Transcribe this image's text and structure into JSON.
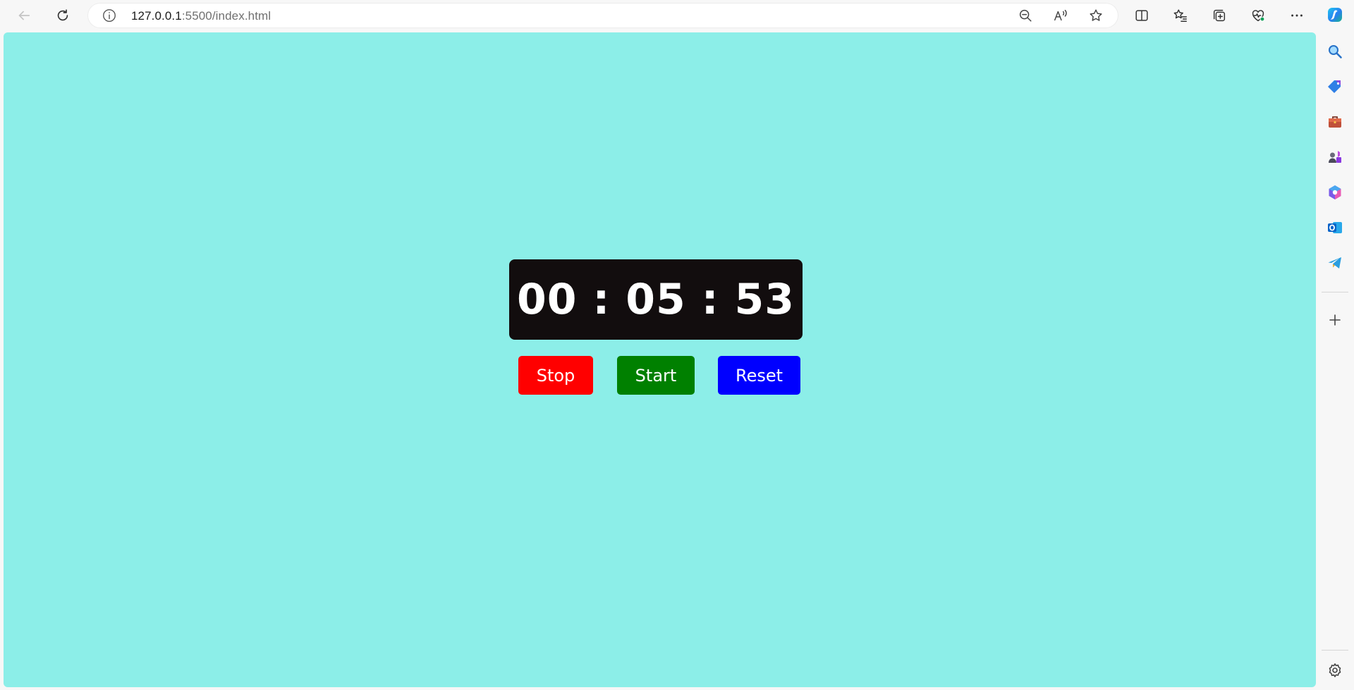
{
  "browser": {
    "url_host": "127.0.0.1",
    "url_rest": ":5500/index.html",
    "toolbar_icons": [
      "back-icon",
      "refresh-icon",
      "info-icon",
      "zoom-out-icon",
      "read-aloud-icon",
      "favorite-star-icon",
      "split-screen-icon",
      "favorites-icon",
      "collections-icon",
      "browser-essentials-icon",
      "more-menu-icon",
      "copilot-icon"
    ],
    "sidebar_icons": [
      "search-icon",
      "shopping-tag-icon",
      "tools-briefcase-icon",
      "games-icon",
      "microsoft365-icon",
      "outlook-icon",
      "telegram-icon",
      "add-icon",
      "settings-icon"
    ]
  },
  "stopwatch": {
    "time": "00 : 05 : 53",
    "buttons": {
      "stop": "Stop",
      "start": "Start",
      "reset": "Reset"
    }
  },
  "colors": {
    "page_background": "#8ceee8",
    "clock_background": "#120d0e",
    "stop": "#ff0000",
    "start": "#008000",
    "reset": "#0000ff"
  }
}
